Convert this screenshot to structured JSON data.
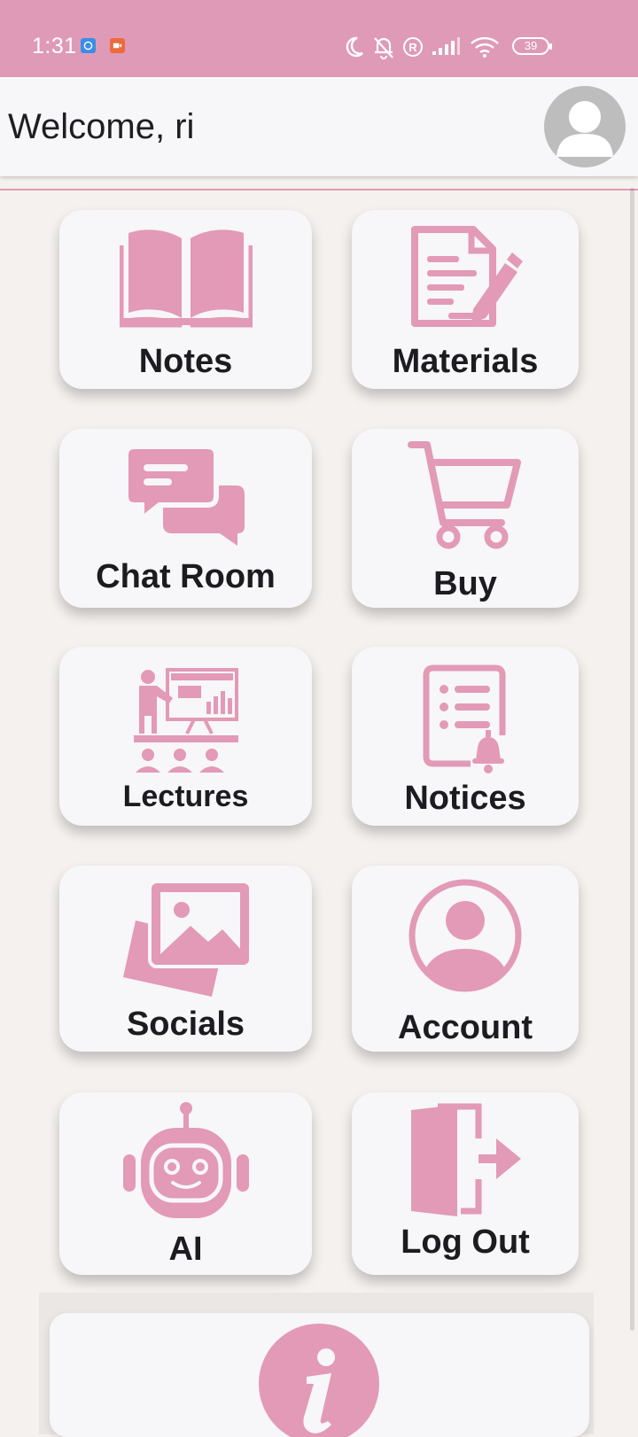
{
  "status_bar": {
    "time": "1:31",
    "battery": "39",
    "icons": [
      "messenger-notification-icon",
      "video-notification-icon",
      "moon-icon",
      "bell-off-icon",
      "registered-icon",
      "signal-icon",
      "wifi-icon",
      "battery-icon"
    ]
  },
  "header": {
    "welcome": "Welcome, ri",
    "avatar_icon": "person-avatar-icon"
  },
  "colors": {
    "accent": "#df9ab8",
    "icon": "#e29ab6",
    "card": "#f7f6f9",
    "background": "#f5f1ee",
    "text": "#1c1c20"
  },
  "menu": [
    {
      "label": "Notes",
      "icon": "open-book-icon"
    },
    {
      "label": "Materials",
      "icon": "document-pen-icon"
    },
    {
      "label": "Chat Room",
      "icon": "chat-bubbles-icon"
    },
    {
      "label": "Buy",
      "icon": "shopping-cart-icon"
    },
    {
      "label": "Lectures",
      "icon": "lecture-presentation-icon"
    },
    {
      "label": "Notices",
      "icon": "notice-list-bell-icon"
    },
    {
      "label": "Socials",
      "icon": "photo-gallery-icon"
    },
    {
      "label": "Account",
      "icon": "account-circle-icon"
    },
    {
      "label": "AI",
      "icon": "robot-icon"
    },
    {
      "label": "Log Out",
      "icon": "exit-door-icon"
    }
  ],
  "info": {
    "icon": "info-icon"
  }
}
